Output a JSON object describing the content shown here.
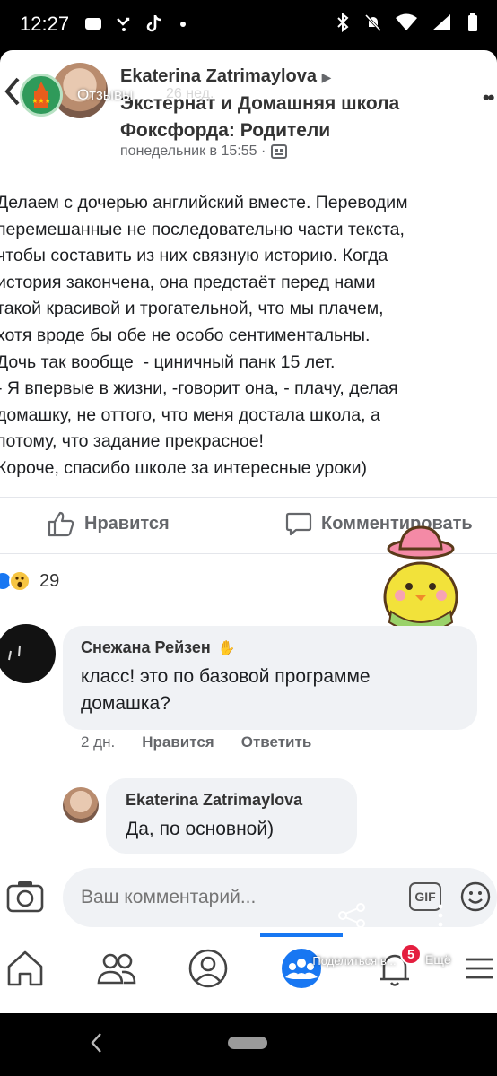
{
  "status_bar": {
    "time": "12:27"
  },
  "story": {
    "label": "Отзывы",
    "time": "26 нед."
  },
  "post": {
    "author": "Ekaterina Zatrimaylova",
    "group": "Экстернат и Домашняя школа Фоксфорда: Родители",
    "meta": "понедельник в 15:55 ·",
    "body": "Делаем с дочерью английский вместе. Переводим\nперемешанные не последовательно части текста,\nчтобы составить из них связную историю. Когда\nистория закончена, она предстаёт перед нами\nтакой красивой и трогательной, что мы плачем,\nхотя вроде бы обе не особо сентиментальны.\nДочь так вообще  - циничный панк 15 лет.\n- Я впервые в жизни, -говорит она, - плачу, делая\nдомашку, не оттого, что меня достала школа, а\nпотому, что задание прекрасное!\nКороче, спасибо школе за интересные уроки)",
    "like_label": "Нравится",
    "comment_label": "Комментировать",
    "reaction_count": "29"
  },
  "comments": [
    {
      "author": "Снежана Рейзен",
      "text": "класс! это по базовой программе\nдомашка?",
      "time": "2 дн.",
      "like": "Нравится",
      "reply": "Ответить"
    },
    {
      "author": "Ekaterina Zatrimaylova",
      "text": "Да, по основной)"
    }
  ],
  "composer": {
    "placeholder": "Ваш комментарий...",
    "gif": "GIF"
  },
  "overlay": {
    "share": "Поделиться в...",
    "more": "Ещё"
  },
  "nav": {
    "notifications_badge": "5"
  },
  "colors": {
    "accent": "#1877f2",
    "badge": "#e41e3f",
    "bubble": "#f0f2f5"
  }
}
